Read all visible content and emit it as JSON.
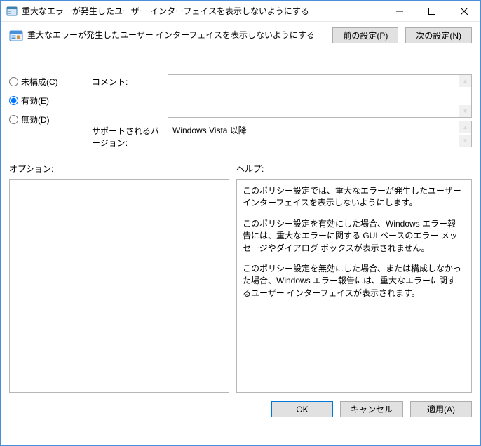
{
  "window": {
    "title": "重大なエラーが発生したユーザー インターフェイスを表示しないようにする"
  },
  "header": {
    "title": "重大なエラーが発生したユーザー インターフェイスを表示しないようにする",
    "prev": "前の設定(P)",
    "next": "次の設定(N)"
  },
  "radios": {
    "not_configured": "未構成(C)",
    "enabled": "有効(E)",
    "disabled": "無効(D)",
    "selected": "enabled"
  },
  "labels": {
    "comment": "コメント:",
    "supported": "サポートされるバージョン:",
    "options": "オプション:",
    "help": "ヘルプ:"
  },
  "fields": {
    "comment_value": "",
    "supported_value": "Windows Vista 以降"
  },
  "help": {
    "p1": "このポリシー設定では、重大なエラーが発生したユーザー インターフェイスを表示しないようにします。",
    "p2": "このポリシー設定を有効にした場合、Windows エラー報告には、重大なエラーに関する GUI ベースのエラー メッセージやダイアログ ボックスが表示されません。",
    "p3": "このポリシー設定を無効にした場合、または構成しなかった場合、Windows エラー報告には、重大なエラーに関するユーザー インターフェイスが表示されます。"
  },
  "footer": {
    "ok": "OK",
    "cancel": "キャンセル",
    "apply": "適用(A)"
  }
}
